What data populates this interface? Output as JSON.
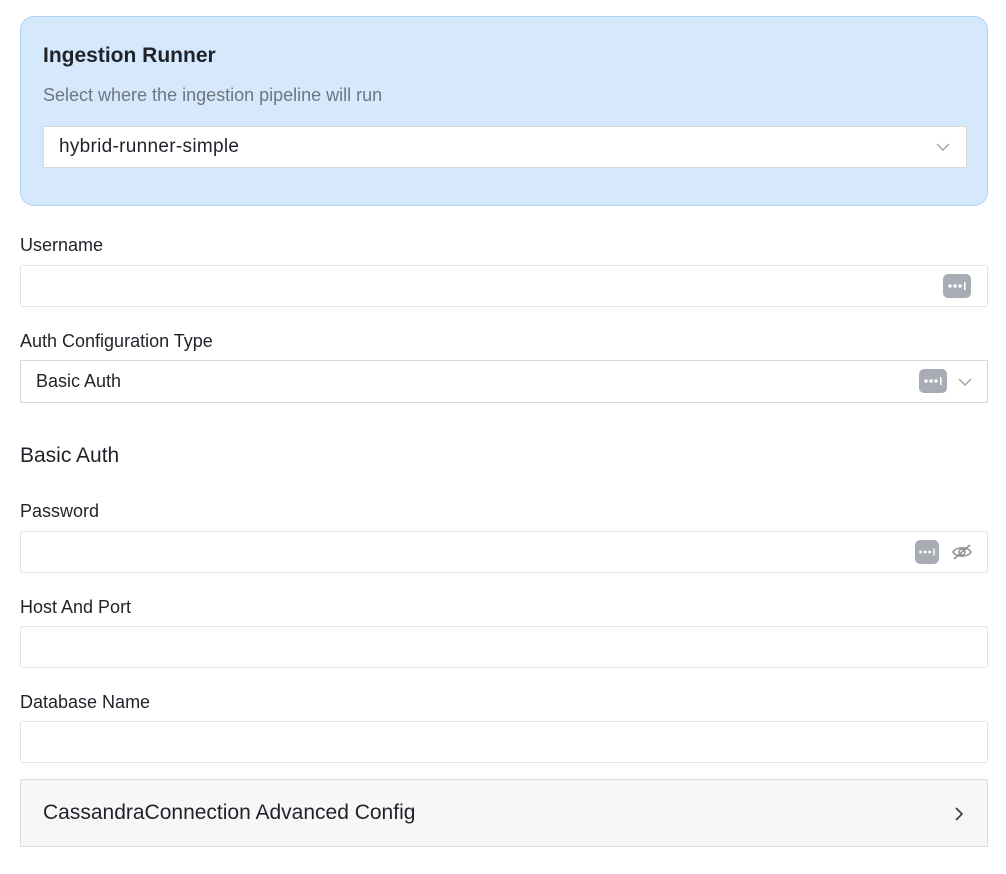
{
  "ingestion_runner": {
    "title": "Ingestion Runner",
    "description": "Select where the ingestion pipeline will run",
    "selected": "hybrid-runner-simple"
  },
  "username": {
    "label": "Username",
    "value": ""
  },
  "auth_config": {
    "label": "Auth Configuration Type",
    "selected": "Basic Auth"
  },
  "basic_auth": {
    "section_title": "Basic Auth",
    "password_label": "Password",
    "password_value": ""
  },
  "host_port": {
    "label": "Host And Port",
    "value": ""
  },
  "database_name": {
    "label": "Database Name",
    "value": ""
  },
  "advanced": {
    "label": "CassandraConnection Advanced Config"
  },
  "icons": {
    "password_manager": "password-dots-icon",
    "eye_hidden": "eye-off-icon",
    "select_arrow": "chevron-down-icon",
    "collapse_arrow": "chevron-right-icon"
  },
  "colors": {
    "card_background": "#d6e9fc",
    "card_border": "#b3d4f5",
    "muted_text": "#6e7680",
    "icon_gray": "#a8adb5"
  }
}
